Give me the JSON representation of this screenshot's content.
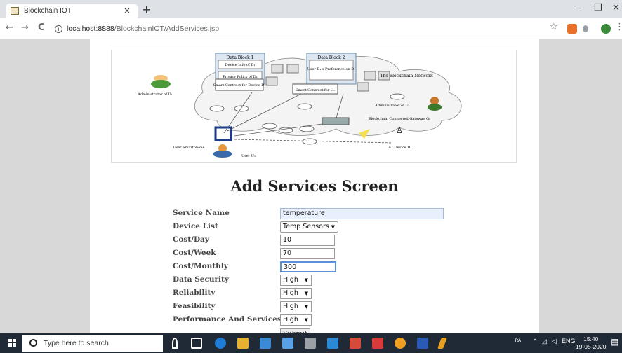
{
  "browser": {
    "tab_title": "Blockchain IOT",
    "tab_close": "×",
    "new_tab": "+",
    "url_host": "localhost:8888",
    "url_path": "/BlockchainIOT/AddServices.jsp",
    "back": "←",
    "forward": "→",
    "reload": "C",
    "star": "☆",
    "minimize": "–",
    "maximize": "❐",
    "close": "✕"
  },
  "banner": {
    "data_block_1": "Data Block 1",
    "device_info": "Device Info of D₁",
    "privacy_policy": "Privacy Policy of D₁",
    "data_block_2": "Data Block 2",
    "user_pref": "User D₁'s Preference on D₁",
    "smart_contract_device": "Smart Contract for Device D₁",
    "smart_contract_user": "Smart Contract for U₁",
    "network": "The Blockchain Network",
    "administrator_left": "Administrator of D₁",
    "administrator_right": "Administrator of U₁",
    "gateway": "Blockchain Connected Gateway G₁",
    "user_smartphone": "User Smartphone",
    "user_label": "User U₁",
    "iot_device": "IoT Device D₁"
  },
  "page": {
    "heading": "Add Services Screen"
  },
  "form": {
    "service_name_label": "Service Name",
    "service_name_value": "temperature",
    "device_list_label": "Device List",
    "device_list_value": "Temp Sensors",
    "cost_day_label": "Cost/Day",
    "cost_day_value": "10",
    "cost_week_label": "Cost/Week",
    "cost_week_value": "70",
    "cost_month_label": "Cost/Monthly",
    "cost_month_value": "300",
    "data_security_label": "Data Security",
    "data_security_value": "High",
    "reliability_label": "Reliability",
    "reliability_value": "High",
    "feasibility_label": "Feasibility",
    "feasibility_value": "High",
    "performance_label": "Performance And Services",
    "performance_value": "High",
    "submit_label": "Submit"
  },
  "taskbar": {
    "search_placeholder": "Type here to search",
    "time": "15:40",
    "date": "19-05-2020",
    "lang": "ENG"
  },
  "colors": {
    "tabstrip": "#dee1e6",
    "page_bg": "#d8d8d8",
    "taskbar": "#1f2a36",
    "focus_border": "#5b8fd6"
  }
}
